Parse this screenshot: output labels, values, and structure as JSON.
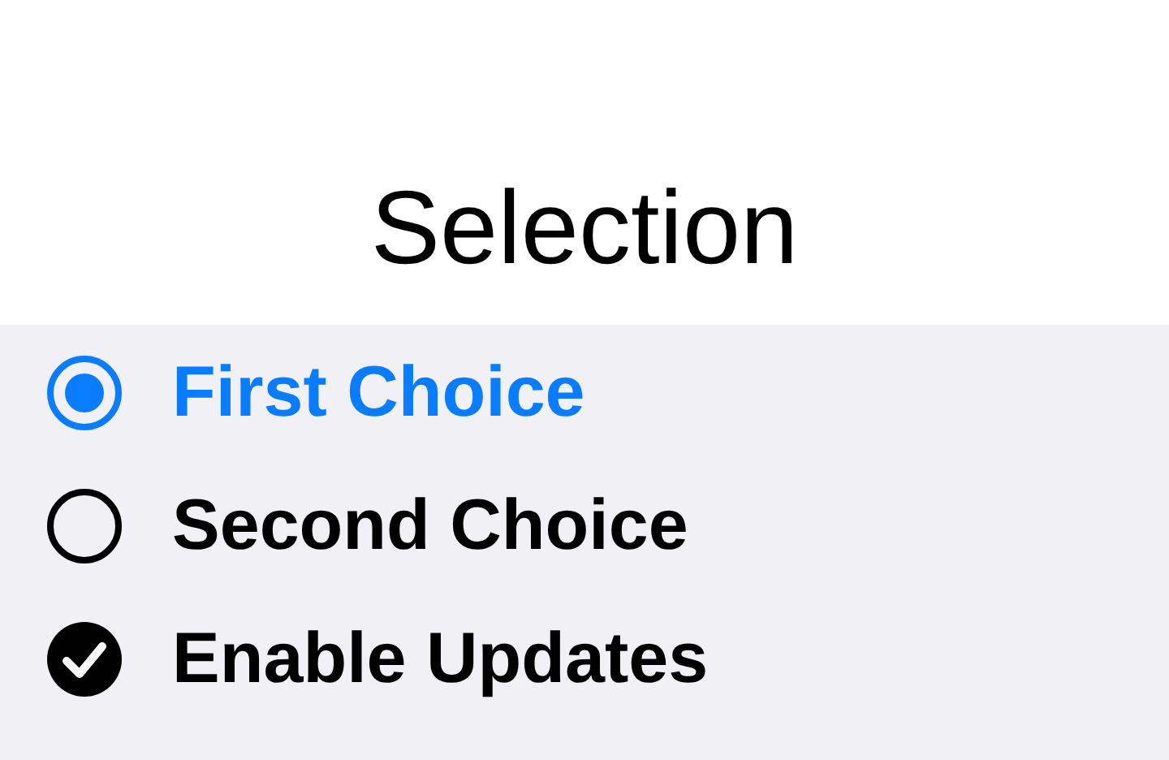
{
  "title": "Selection",
  "options": [
    {
      "kind": "radio",
      "label": "First Choice",
      "selected": true
    },
    {
      "kind": "radio",
      "label": "Second Choice",
      "selected": false
    },
    {
      "kind": "checkbox",
      "label": "Enable Updates",
      "checked": true
    }
  ]
}
